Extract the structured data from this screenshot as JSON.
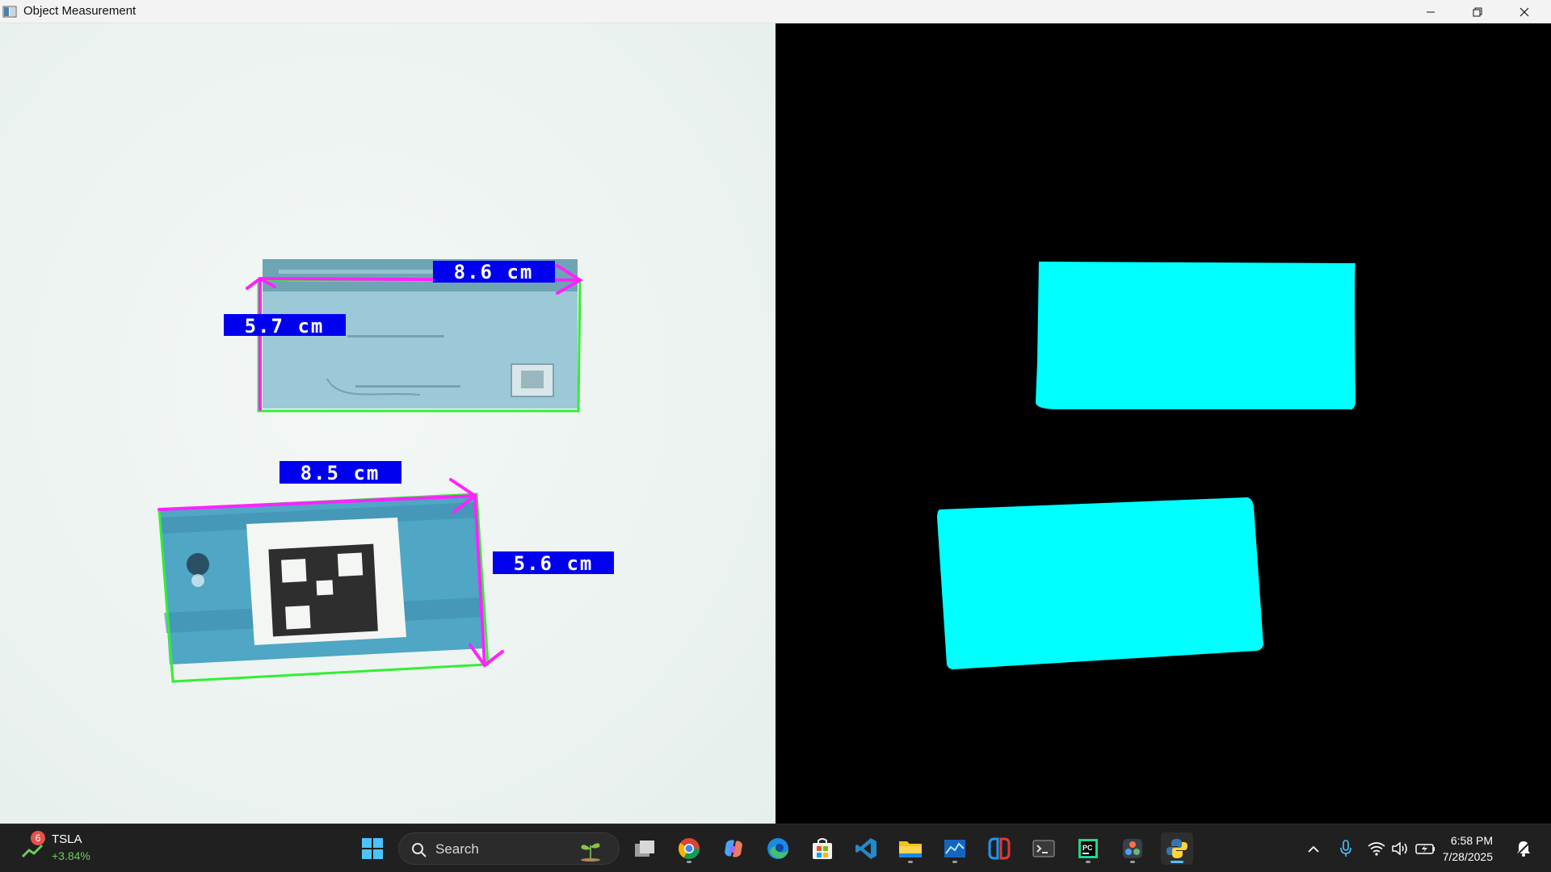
{
  "window": {
    "title": "Object Measurement",
    "controls": [
      "minimize",
      "restore",
      "close"
    ]
  },
  "measurements": [
    {
      "object": "card-top",
      "width_label": "8.6 cm",
      "height_label": "5.7 cm"
    },
    {
      "object": "card-bottom",
      "width_label": "8.5 cm",
      "height_label": "5.6 cm"
    }
  ],
  "colors": {
    "contour": "#33ee33",
    "arrow": "#ff22ff",
    "label_bg": "#0000ee",
    "label_text": "#ffffff",
    "mask_fill": "#00ffff",
    "mask_bg": "#000000"
  },
  "taskbar": {
    "stock": {
      "badge": "6",
      "ticker": "TSLA",
      "change": "+3.84%"
    },
    "search": {
      "label": "Search"
    },
    "pinned": [
      "windows-start-icon",
      "task-view-icon",
      "chrome-icon",
      "copilot-icon",
      "edge-icon",
      "microsoft-store-icon",
      "vscode-icon",
      "file-explorer-icon",
      "resource-monitor-icon",
      "nintendo-switch-icon",
      "terminal-icon",
      "pycharm-icon",
      "davinci-resolve-icon",
      "python-icon"
    ],
    "clock": {
      "time": "6:58 PM",
      "date": "7/28/2025"
    }
  }
}
